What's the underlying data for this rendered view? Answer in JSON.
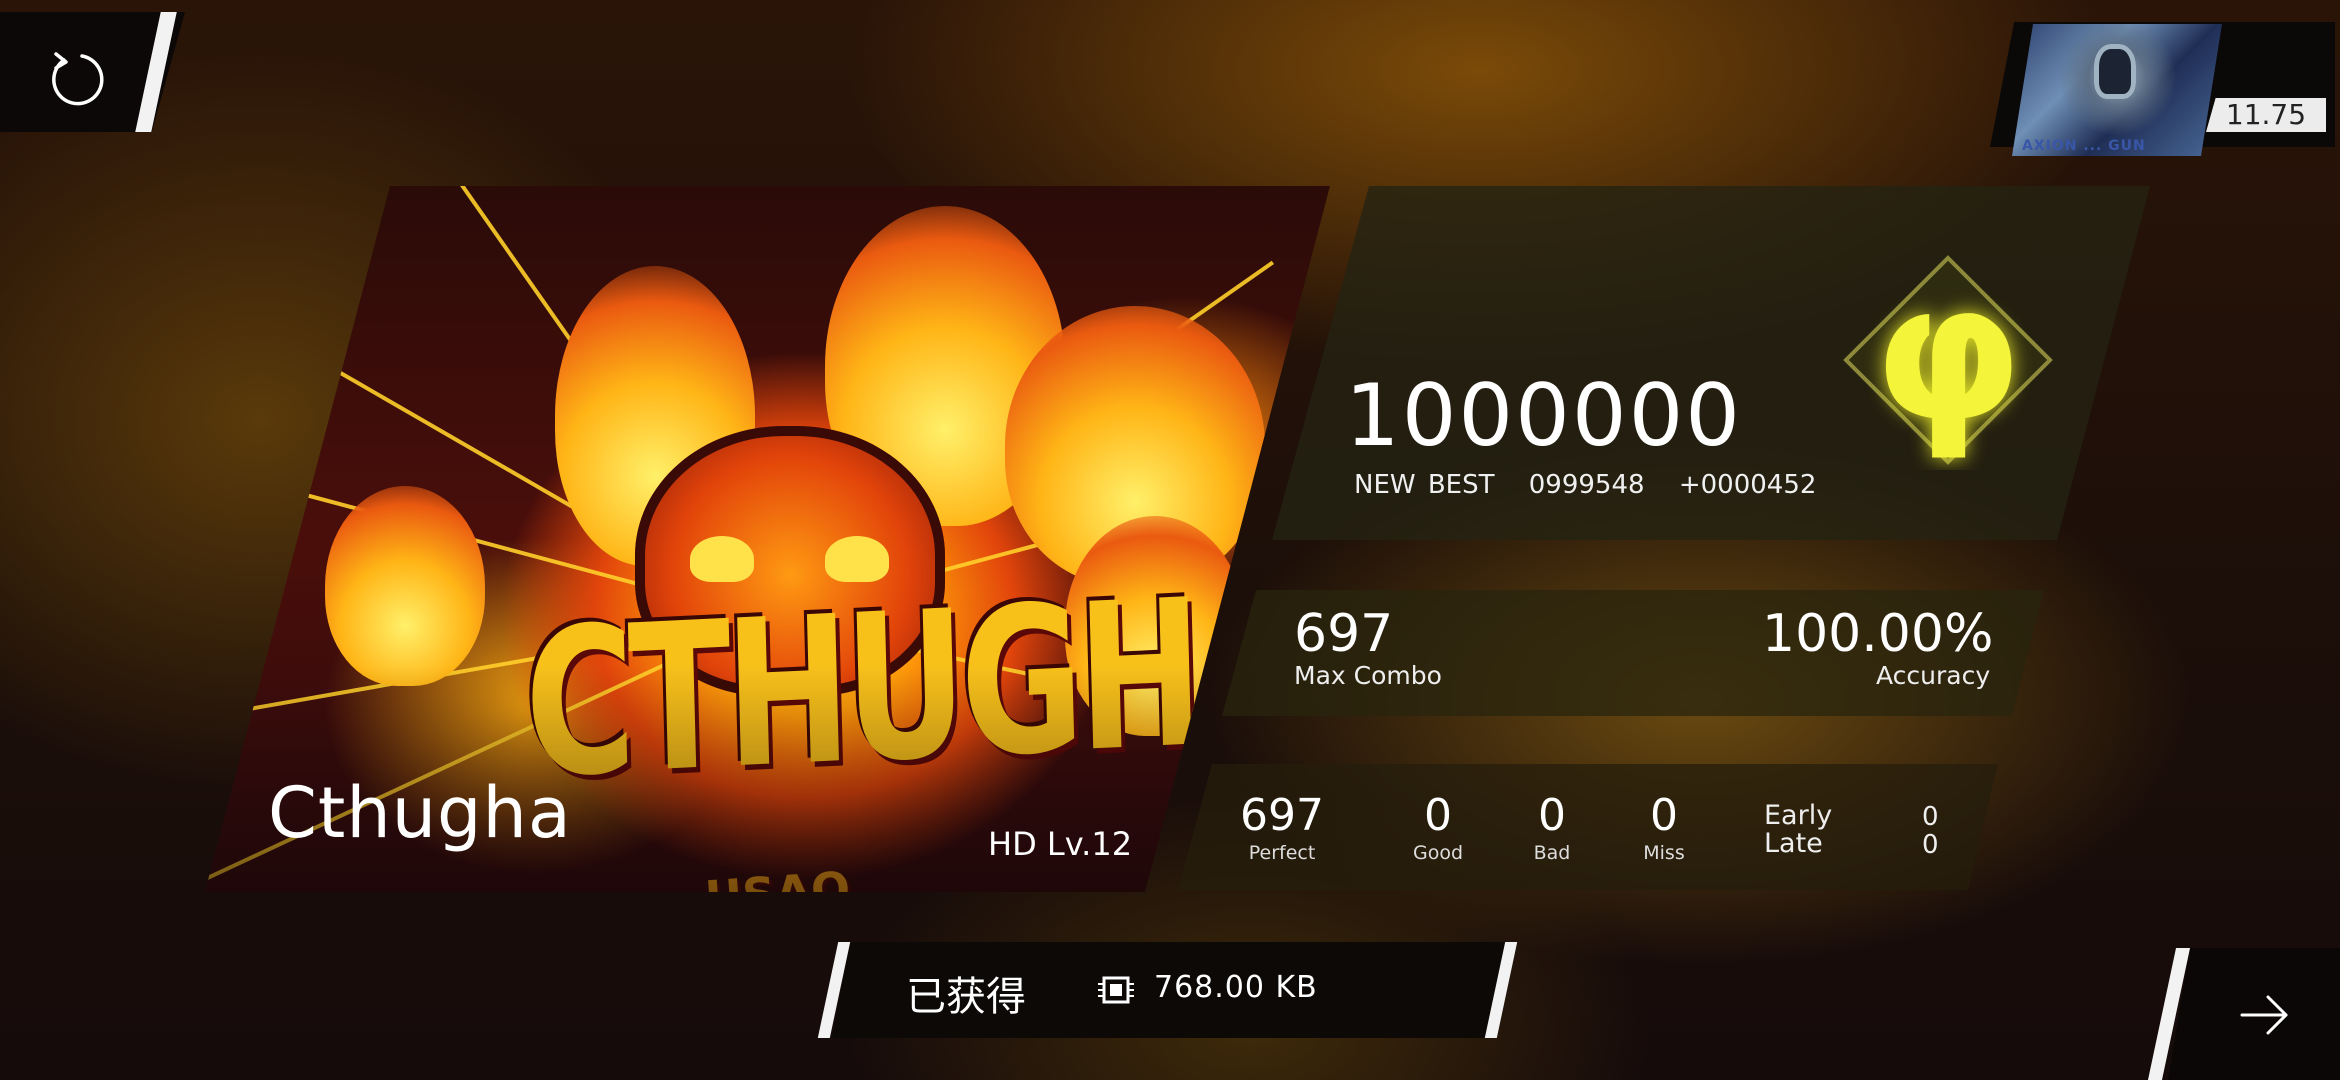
{
  "header": {
    "restart_icon": "restart-icon",
    "player_rks": "11.75",
    "avatar_caption": "AXION ... GUN"
  },
  "song": {
    "title": "Cthugha",
    "difficulty": "HD  Lv.12",
    "jacket_logo": "CTHUGHA",
    "jacket_artist": "USAO"
  },
  "score": {
    "value": "1000000",
    "new_best_label": "NEW BEST",
    "previous_best": "0999548",
    "delta": "+0000452",
    "grade": "φ",
    "grade_color": "#f4f43a"
  },
  "combo": {
    "max_combo": "697",
    "max_combo_label": "Max Combo",
    "accuracy": "100.00%",
    "accuracy_label": "Accuracy"
  },
  "judgements": {
    "perfect": "697",
    "perfect_label": "Perfect",
    "good": "0",
    "good_label": "Good",
    "bad": "0",
    "bad_label": "Bad",
    "miss": "0",
    "miss_label": "Miss",
    "early_label": "Early",
    "early": "0",
    "late_label": "Late",
    "late": "0"
  },
  "bottom": {
    "obtained_label": "已获得",
    "chip_icon": "chip-icon",
    "size": "768.00 KB"
  },
  "next": {
    "arrow_icon": "arrow-right-icon"
  }
}
